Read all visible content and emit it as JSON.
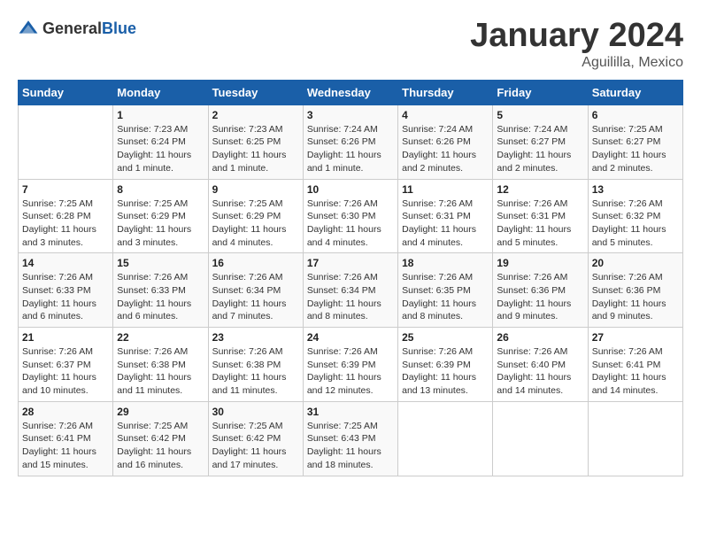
{
  "logo": {
    "text_general": "General",
    "text_blue": "Blue"
  },
  "header": {
    "month": "January 2024",
    "location": "Aguililla, Mexico"
  },
  "weekdays": [
    "Sunday",
    "Monday",
    "Tuesday",
    "Wednesday",
    "Thursday",
    "Friday",
    "Saturday"
  ],
  "weeks": [
    [
      {
        "day": "",
        "sunrise": "",
        "sunset": "",
        "daylight": ""
      },
      {
        "day": "1",
        "sunrise": "Sunrise: 7:23 AM",
        "sunset": "Sunset: 6:24 PM",
        "daylight": "Daylight: 11 hours and 1 minute."
      },
      {
        "day": "2",
        "sunrise": "Sunrise: 7:23 AM",
        "sunset": "Sunset: 6:25 PM",
        "daylight": "Daylight: 11 hours and 1 minute."
      },
      {
        "day": "3",
        "sunrise": "Sunrise: 7:24 AM",
        "sunset": "Sunset: 6:26 PM",
        "daylight": "Daylight: 11 hours and 1 minute."
      },
      {
        "day": "4",
        "sunrise": "Sunrise: 7:24 AM",
        "sunset": "Sunset: 6:26 PM",
        "daylight": "Daylight: 11 hours and 2 minutes."
      },
      {
        "day": "5",
        "sunrise": "Sunrise: 7:24 AM",
        "sunset": "Sunset: 6:27 PM",
        "daylight": "Daylight: 11 hours and 2 minutes."
      },
      {
        "day": "6",
        "sunrise": "Sunrise: 7:25 AM",
        "sunset": "Sunset: 6:27 PM",
        "daylight": "Daylight: 11 hours and 2 minutes."
      }
    ],
    [
      {
        "day": "7",
        "sunrise": "Sunrise: 7:25 AM",
        "sunset": "Sunset: 6:28 PM",
        "daylight": "Daylight: 11 hours and 3 minutes."
      },
      {
        "day": "8",
        "sunrise": "Sunrise: 7:25 AM",
        "sunset": "Sunset: 6:29 PM",
        "daylight": "Daylight: 11 hours and 3 minutes."
      },
      {
        "day": "9",
        "sunrise": "Sunrise: 7:25 AM",
        "sunset": "Sunset: 6:29 PM",
        "daylight": "Daylight: 11 hours and 4 minutes."
      },
      {
        "day": "10",
        "sunrise": "Sunrise: 7:26 AM",
        "sunset": "Sunset: 6:30 PM",
        "daylight": "Daylight: 11 hours and 4 minutes."
      },
      {
        "day": "11",
        "sunrise": "Sunrise: 7:26 AM",
        "sunset": "Sunset: 6:31 PM",
        "daylight": "Daylight: 11 hours and 4 minutes."
      },
      {
        "day": "12",
        "sunrise": "Sunrise: 7:26 AM",
        "sunset": "Sunset: 6:31 PM",
        "daylight": "Daylight: 11 hours and 5 minutes."
      },
      {
        "day": "13",
        "sunrise": "Sunrise: 7:26 AM",
        "sunset": "Sunset: 6:32 PM",
        "daylight": "Daylight: 11 hours and 5 minutes."
      }
    ],
    [
      {
        "day": "14",
        "sunrise": "Sunrise: 7:26 AM",
        "sunset": "Sunset: 6:33 PM",
        "daylight": "Daylight: 11 hours and 6 minutes."
      },
      {
        "day": "15",
        "sunrise": "Sunrise: 7:26 AM",
        "sunset": "Sunset: 6:33 PM",
        "daylight": "Daylight: 11 hours and 6 minutes."
      },
      {
        "day": "16",
        "sunrise": "Sunrise: 7:26 AM",
        "sunset": "Sunset: 6:34 PM",
        "daylight": "Daylight: 11 hours and 7 minutes."
      },
      {
        "day": "17",
        "sunrise": "Sunrise: 7:26 AM",
        "sunset": "Sunset: 6:34 PM",
        "daylight": "Daylight: 11 hours and 8 minutes."
      },
      {
        "day": "18",
        "sunrise": "Sunrise: 7:26 AM",
        "sunset": "Sunset: 6:35 PM",
        "daylight": "Daylight: 11 hours and 8 minutes."
      },
      {
        "day": "19",
        "sunrise": "Sunrise: 7:26 AM",
        "sunset": "Sunset: 6:36 PM",
        "daylight": "Daylight: 11 hours and 9 minutes."
      },
      {
        "day": "20",
        "sunrise": "Sunrise: 7:26 AM",
        "sunset": "Sunset: 6:36 PM",
        "daylight": "Daylight: 11 hours and 9 minutes."
      }
    ],
    [
      {
        "day": "21",
        "sunrise": "Sunrise: 7:26 AM",
        "sunset": "Sunset: 6:37 PM",
        "daylight": "Daylight: 11 hours and 10 minutes."
      },
      {
        "day": "22",
        "sunrise": "Sunrise: 7:26 AM",
        "sunset": "Sunset: 6:38 PM",
        "daylight": "Daylight: 11 hours and 11 minutes."
      },
      {
        "day": "23",
        "sunrise": "Sunrise: 7:26 AM",
        "sunset": "Sunset: 6:38 PM",
        "daylight": "Daylight: 11 hours and 11 minutes."
      },
      {
        "day": "24",
        "sunrise": "Sunrise: 7:26 AM",
        "sunset": "Sunset: 6:39 PM",
        "daylight": "Daylight: 11 hours and 12 minutes."
      },
      {
        "day": "25",
        "sunrise": "Sunrise: 7:26 AM",
        "sunset": "Sunset: 6:39 PM",
        "daylight": "Daylight: 11 hours and 13 minutes."
      },
      {
        "day": "26",
        "sunrise": "Sunrise: 7:26 AM",
        "sunset": "Sunset: 6:40 PM",
        "daylight": "Daylight: 11 hours and 14 minutes."
      },
      {
        "day": "27",
        "sunrise": "Sunrise: 7:26 AM",
        "sunset": "Sunset: 6:41 PM",
        "daylight": "Daylight: 11 hours and 14 minutes."
      }
    ],
    [
      {
        "day": "28",
        "sunrise": "Sunrise: 7:26 AM",
        "sunset": "Sunset: 6:41 PM",
        "daylight": "Daylight: 11 hours and 15 minutes."
      },
      {
        "day": "29",
        "sunrise": "Sunrise: 7:25 AM",
        "sunset": "Sunset: 6:42 PM",
        "daylight": "Daylight: 11 hours and 16 minutes."
      },
      {
        "day": "30",
        "sunrise": "Sunrise: 7:25 AM",
        "sunset": "Sunset: 6:42 PM",
        "daylight": "Daylight: 11 hours and 17 minutes."
      },
      {
        "day": "31",
        "sunrise": "Sunrise: 7:25 AM",
        "sunset": "Sunset: 6:43 PM",
        "daylight": "Daylight: 11 hours and 18 minutes."
      },
      {
        "day": "",
        "sunrise": "",
        "sunset": "",
        "daylight": ""
      },
      {
        "day": "",
        "sunrise": "",
        "sunset": "",
        "daylight": ""
      },
      {
        "day": "",
        "sunrise": "",
        "sunset": "",
        "daylight": ""
      }
    ]
  ]
}
